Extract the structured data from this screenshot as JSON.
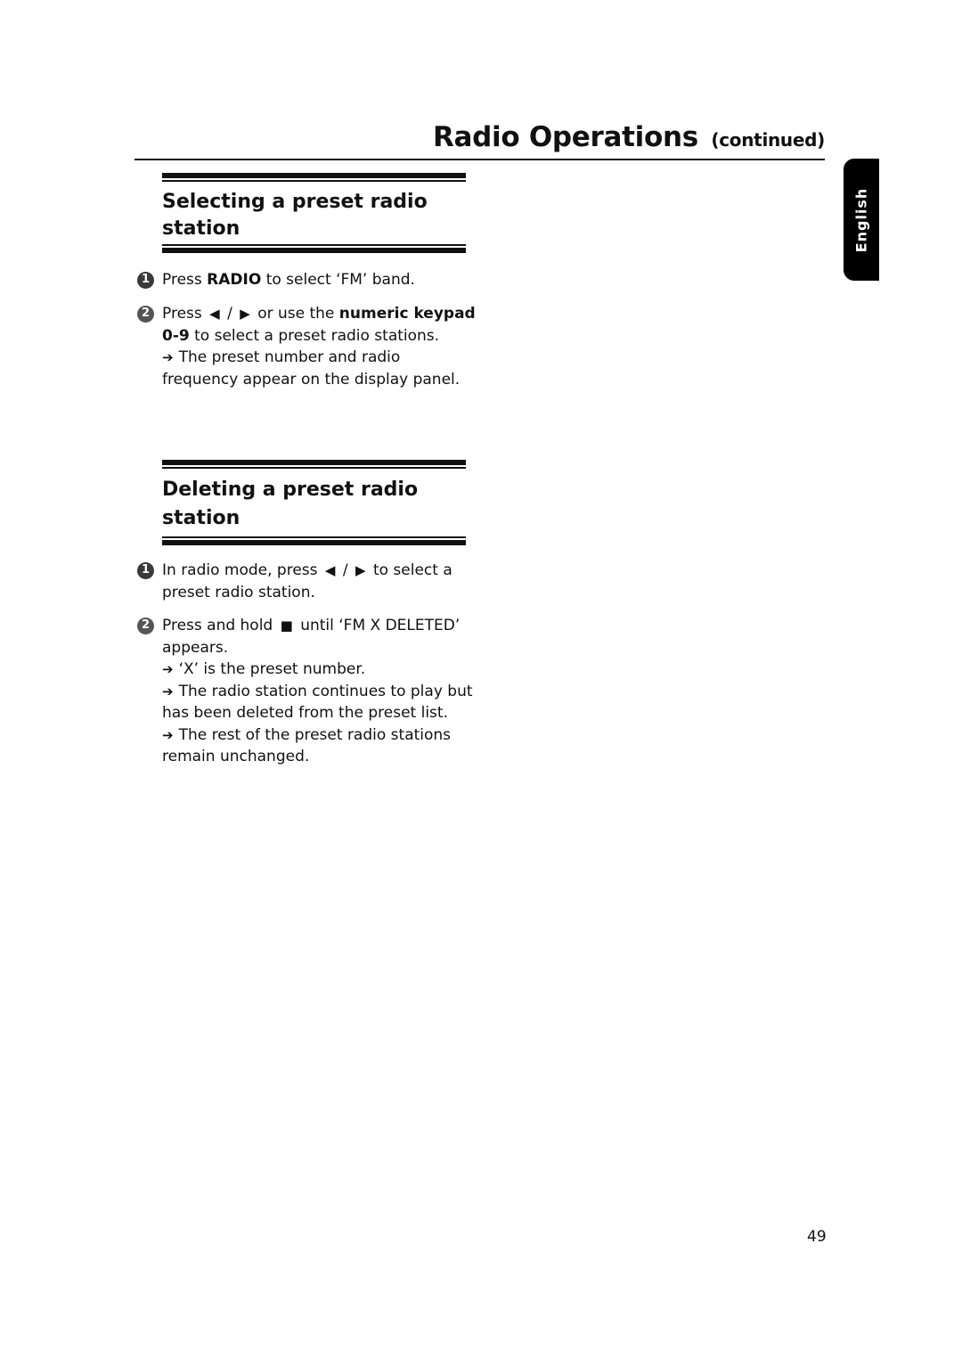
{
  "header": {
    "title": "Radio Operations",
    "continued": "(continued)"
  },
  "language_tab": "English",
  "sections": [
    {
      "title": "Selecting a preset radio station",
      "steps": [
        {
          "number": "1",
          "parts": [
            "Press ",
            "RADIO",
            " to select ‘FM’ band."
          ]
        },
        {
          "number": "2",
          "parts": [
            "Press ",
            "⏮",
            " / ",
            "⏭",
            " or use the ",
            "numeric keypad 0-9",
            " to select a preset radio stations."
          ],
          "notes": [
            "The preset number and radio frequency appear on the display panel."
          ]
        }
      ]
    },
    {
      "title": "Deleting a preset radio station",
      "steps": [
        {
          "number": "1",
          "parts": [
            "In radio mode, press ",
            "⏮",
            " / ",
            "⏭",
            " to select a preset radio station."
          ]
        },
        {
          "number": "2",
          "parts": [
            "Press and hold ",
            "■",
            " until ‘FM X DELETED’ appears."
          ],
          "notes": [
            "‘X’ is the preset number.",
            "The radio station continues to play but has been deleted from the preset list.",
            "The rest of the preset radio stations remain unchanged."
          ]
        }
      ]
    }
  ],
  "icons": {
    "previous": "previous-track-icon",
    "next": "next-track-icon",
    "stop": "stop-icon",
    "arrow": "➔"
  },
  "page_number": "49"
}
